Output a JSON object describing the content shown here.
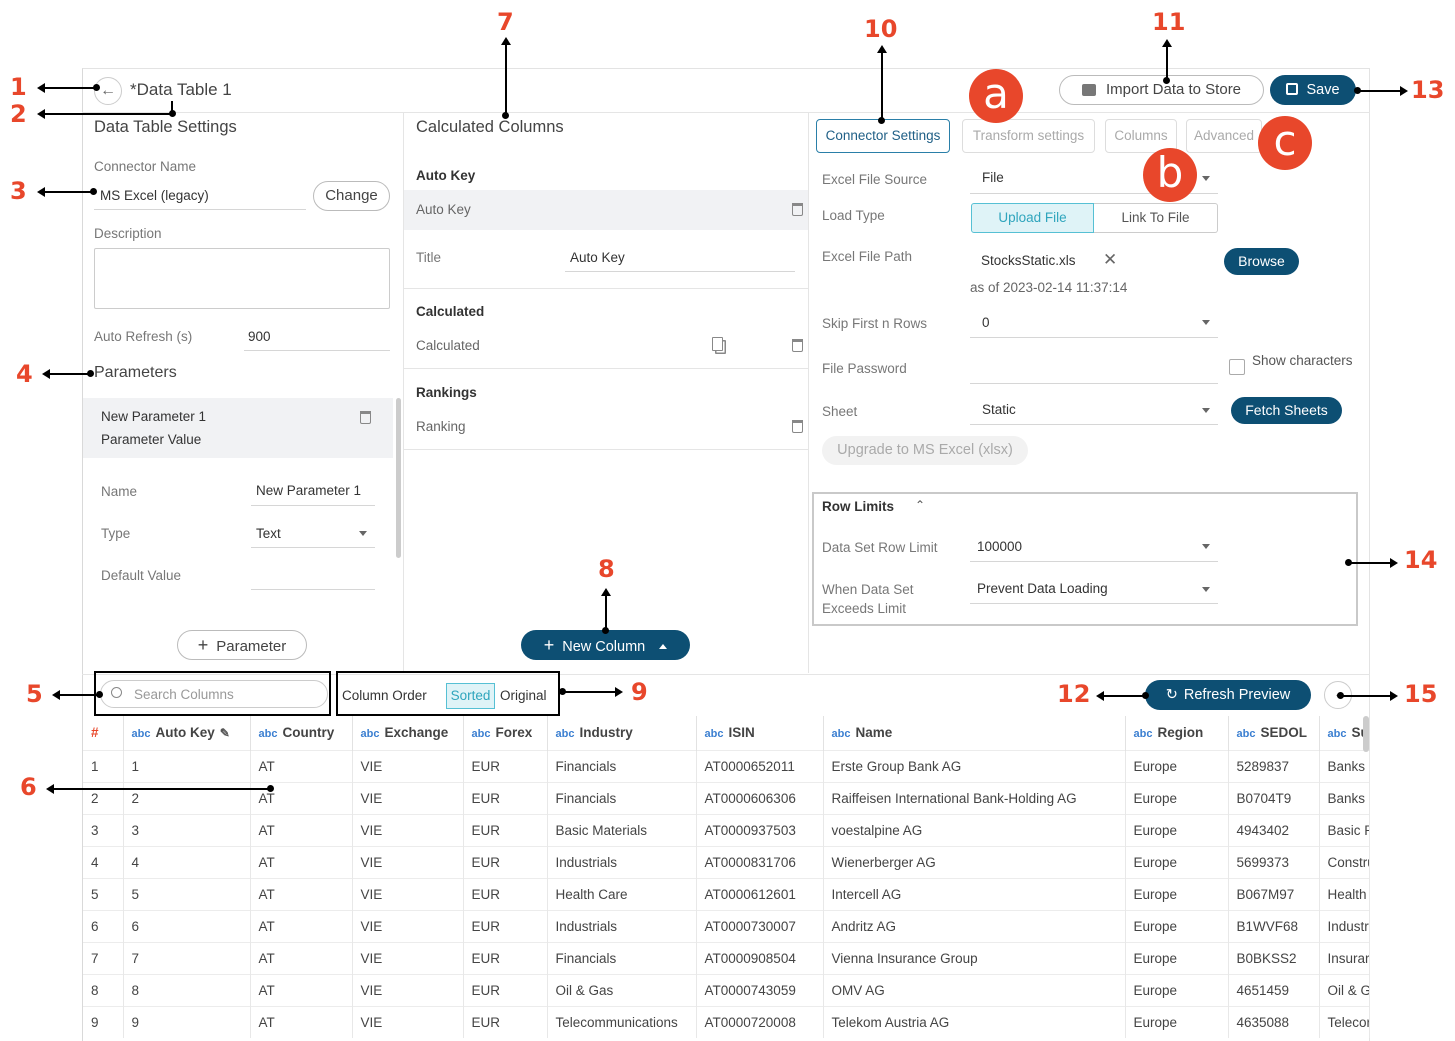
{
  "callouts": [
    "1",
    "2",
    "3",
    "4",
    "5",
    "6",
    "7",
    "8",
    "9",
    "10",
    "11",
    "12",
    "13",
    "14",
    "15"
  ],
  "letter_markers": [
    "a",
    "b",
    "c"
  ],
  "header": {
    "title": "*Data Table 1",
    "import_label": "Import Data to Store",
    "save_label": "Save"
  },
  "settings": {
    "section_title": "Data Table Settings",
    "connector_label": "Connector Name",
    "connector_value": "MS Excel (legacy)",
    "change_label": "Change",
    "description_label": "Description",
    "auto_refresh_label": "Auto Refresh (s)",
    "auto_refresh_value": "900",
    "parameters_title": "Parameters",
    "param_name_line": "New Parameter 1",
    "param_value_line": "Parameter Value",
    "name_label": "Name",
    "name_value": "New Parameter 1",
    "type_label": "Type",
    "type_value": "Text",
    "default_label": "Default Value",
    "add_param_label": "Parameter"
  },
  "calc": {
    "section_title": "Calculated Columns",
    "autokey_header": "Auto Key",
    "autokey_item": "Auto Key",
    "title_label": "Title",
    "title_value": "Auto Key",
    "calculated_header": "Calculated",
    "calculated_item": "Calculated",
    "rankings_header": "Rankings",
    "ranking_item": "Ranking",
    "new_column_label": "New Column"
  },
  "connector": {
    "tabs": [
      "Connector Settings",
      "Transform settings",
      "Columns",
      "Advanced"
    ],
    "excel_source_label": "Excel File Source",
    "excel_source_value": "File",
    "load_type_label": "Load Type",
    "upload_label": "Upload File",
    "link_label": "Link To File",
    "path_label": "Excel File Path",
    "path_value": "StocksStatic.xls",
    "as_of": "as of 2023-02-14 11:37:14",
    "browse_label": "Browse",
    "skip_label": "Skip First n Rows",
    "skip_value": "0",
    "password_label": "File Password",
    "show_chars_label": "Show characters",
    "sheet_label": "Sheet",
    "sheet_value": "Static",
    "fetch_label": "Fetch Sheets",
    "upgrade_label": "Upgrade to MS Excel (xlsx)",
    "row_limits_title": "Row Limits",
    "row_limit_label": "Data Set Row Limit",
    "row_limit_value": "100000",
    "exceeds_label_1": "When Data Set",
    "exceeds_label_2": "Exceeds Limit",
    "exceeds_value": "Prevent Data Loading"
  },
  "preview": {
    "search_placeholder": "Search Columns",
    "column_order_label": "Column Order",
    "sorted_label": "Sorted",
    "original_label": "Original",
    "refresh_label": "Refresh Preview",
    "type_tag": "abc",
    "hash_label": "#",
    "columns": [
      "Auto Key",
      "Country",
      "Exchange",
      "Forex",
      "Industry",
      "ISIN",
      "Name",
      "Region",
      "SEDOL",
      "Su"
    ],
    "rows": [
      [
        "1",
        "1",
        "AT",
        "VIE",
        "EUR",
        "Financials",
        "AT0000652011",
        "Erste Group Bank AG",
        "Europe",
        "5289837",
        "Banks"
      ],
      [
        "2",
        "2",
        "AT",
        "VIE",
        "EUR",
        "Financials",
        "AT0000606306",
        "Raiffeisen International Bank-Holding AG",
        "Europe",
        "B0704T9",
        "Banks"
      ],
      [
        "3",
        "3",
        "AT",
        "VIE",
        "EUR",
        "Basic Materials",
        "AT0000937503",
        "voestalpine AG",
        "Europe",
        "4943402",
        "Basic R"
      ],
      [
        "4",
        "4",
        "AT",
        "VIE",
        "EUR",
        "Industrials",
        "AT0000831706",
        "Wienerberger AG",
        "Europe",
        "5699373",
        "Constru"
      ],
      [
        "5",
        "5",
        "AT",
        "VIE",
        "EUR",
        "Health Care",
        "AT0000612601",
        "Intercell AG",
        "Europe",
        "B067M97",
        "Health"
      ],
      [
        "6",
        "6",
        "AT",
        "VIE",
        "EUR",
        "Industrials",
        "AT0000730007",
        "Andritz AG",
        "Europe",
        "B1WVF68",
        "Industr"
      ],
      [
        "7",
        "7",
        "AT",
        "VIE",
        "EUR",
        "Financials",
        "AT0000908504",
        "Vienna Insurance Group",
        "Europe",
        "B0BKSS2",
        "Insurar"
      ],
      [
        "8",
        "8",
        "AT",
        "VIE",
        "EUR",
        "Oil & Gas",
        "AT0000743059",
        "OMV AG",
        "Europe",
        "4651459",
        "Oil & G"
      ],
      [
        "9",
        "9",
        "AT",
        "VIE",
        "EUR",
        "Telecommunications",
        "AT0000720008",
        "Telekom Austria AG",
        "Europe",
        "4635088",
        "Telecor"
      ]
    ]
  },
  "colors": {
    "accent": "#0d4f73",
    "callout": "#e8472b",
    "active_tab": "#2a7fa8"
  }
}
